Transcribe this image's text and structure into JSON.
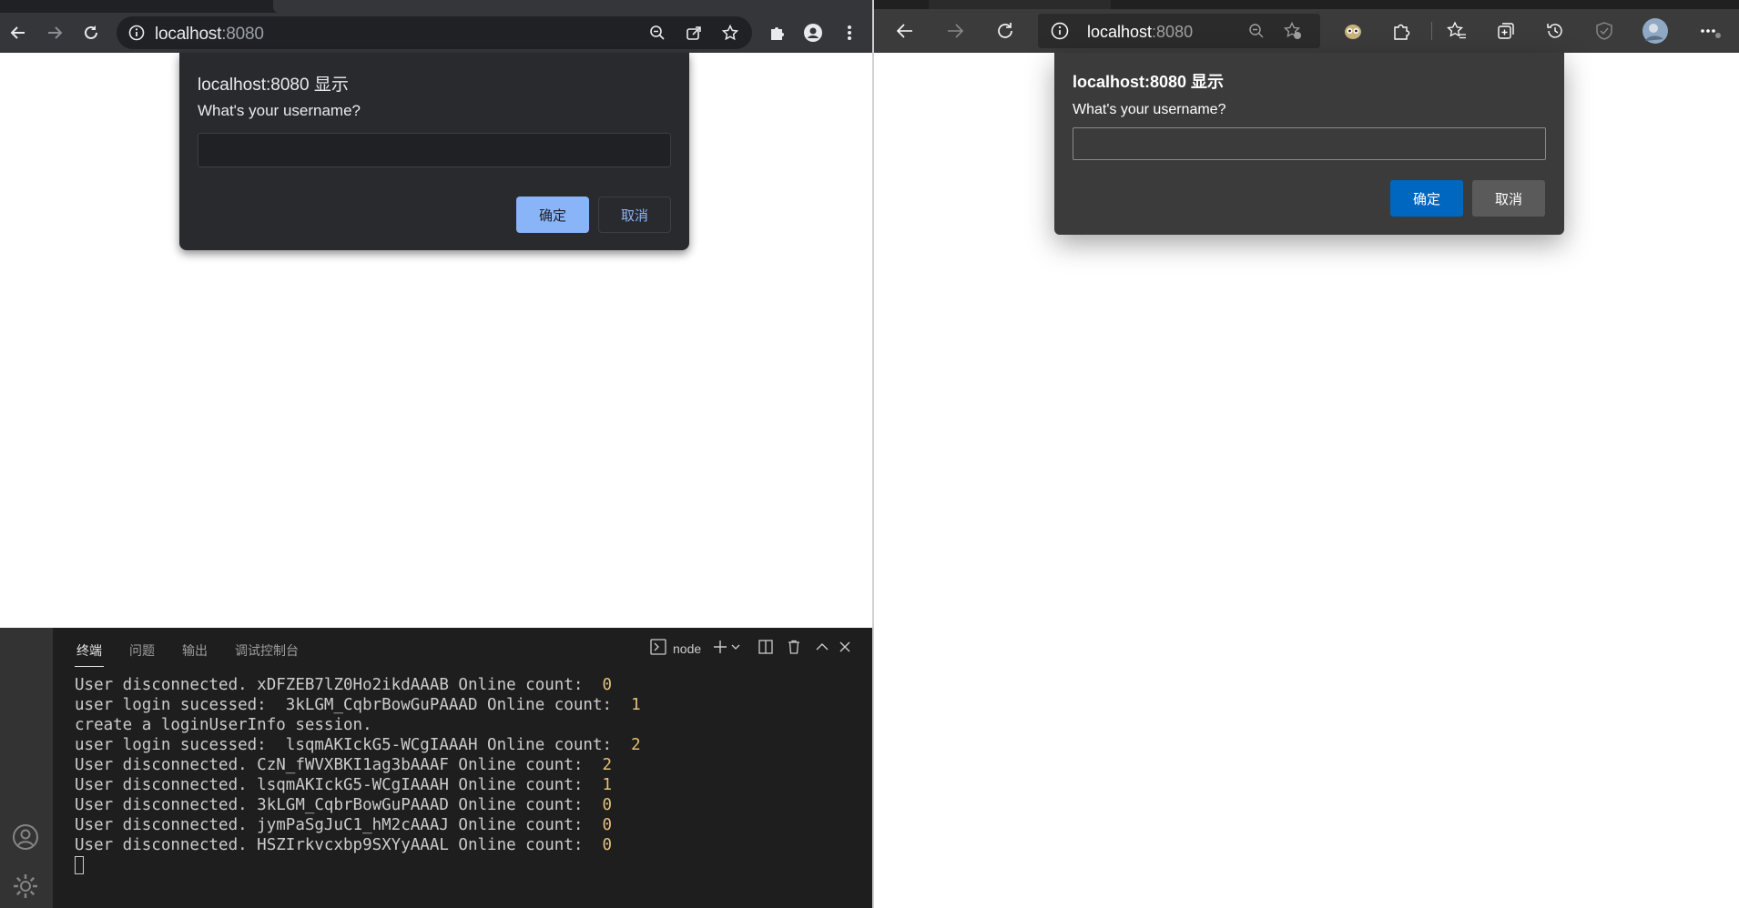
{
  "colors": {
    "chrome_toolbar": "#35363a",
    "chrome_dialog": "#292a2d",
    "chrome_ok_button": "#8ab4f8",
    "edge_toolbar": "#3b3b3b",
    "edge_ok_button": "#0067c0",
    "terminal_bg": "#1e1e1e",
    "terminal_number": "#e5c07b"
  },
  "left_browser": {
    "url_host": "localhost",
    "url_port": ":8080",
    "dialog": {
      "title": "localhost:8080 显示",
      "message": "What's your username?",
      "input_value": "",
      "ok_label": "确定",
      "cancel_label": "取消"
    }
  },
  "vscode": {
    "tabs": [
      {
        "label": "终端",
        "active": true
      },
      {
        "label": "问题",
        "active": false
      },
      {
        "label": "输出",
        "active": false
      },
      {
        "label": "调试控制台",
        "active": false
      }
    ],
    "terminal_name": "node",
    "lines": [
      {
        "text": "User disconnected. xDFZEB7lZ0Ho2ikdAAAB Online count:  ",
        "num": "0"
      },
      {
        "text": "user login sucessed:  3kLGM_CqbrBowGuPAAAD Online count:  ",
        "num": "1"
      },
      {
        "text": "create a loginUserInfo session.",
        "num": ""
      },
      {
        "text": "user login sucessed:  lsqmAKIckG5-WCgIAAAH Online count:  ",
        "num": "2"
      },
      {
        "text": "User disconnected. CzN_fWVXBKI1ag3bAAAF Online count:  ",
        "num": "2"
      },
      {
        "text": "User disconnected. lsqmAKIckG5-WCgIAAAH Online count:  ",
        "num": "1"
      },
      {
        "text": "User disconnected. 3kLGM_CqbrBowGuPAAAD Online count:  ",
        "num": "0"
      },
      {
        "text": "User disconnected. jymPaSgJuC1_hM2cAAAJ Online count:  ",
        "num": "0"
      },
      {
        "text": "User disconnected. HSZIrkvcxbp9SXYyAAAL Online count:  ",
        "num": "0"
      }
    ]
  },
  "right_browser": {
    "url_host": "localhost",
    "url_port": ":8080",
    "dialog": {
      "title": "localhost:8080 显示",
      "message": "What's your username?",
      "input_value": "",
      "ok_label": "确定",
      "cancel_label": "取消"
    }
  }
}
